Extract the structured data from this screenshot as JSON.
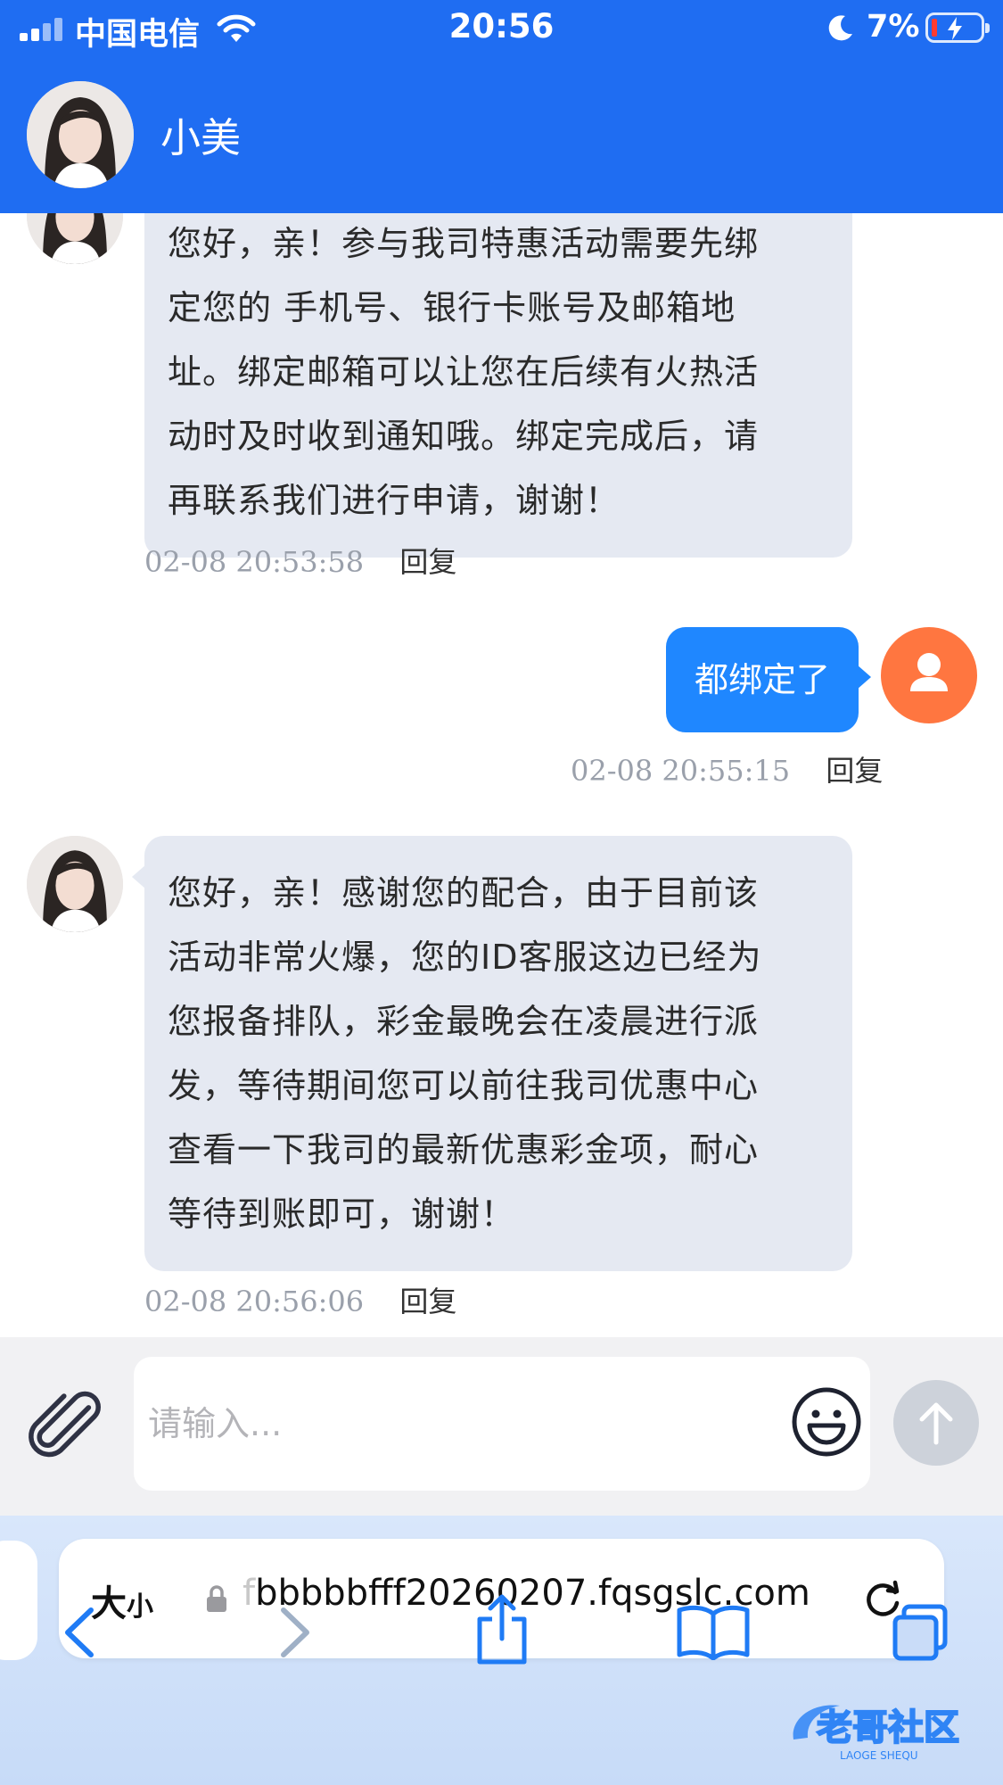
{
  "status_bar": {
    "carrier": "中国电信",
    "time": "20:56",
    "battery": "7%",
    "battery_level": 0.07
  },
  "header": {
    "contact_name": "小美"
  },
  "messages": [
    {
      "side": "left",
      "lines": [
        "您好，亲！参与我司特惠活动需要先绑",
        "定您的 手机号、银行卡账号及邮箱地",
        "址。绑定邮箱可以让您在后续有火热活",
        "动时及时收到通知哦。绑定完成后，请",
        "再联系我们进行申请，谢谢！"
      ],
      "timestamp": "02-08 20:53:58",
      "reply": "回复"
    },
    {
      "side": "right",
      "text": "都绑定了",
      "timestamp": "02-08 20:55:15",
      "reply": "回复"
    },
    {
      "side": "left",
      "lines": [
        "您好，亲！感谢您的配合，由于目前该",
        "活动非常火爆，您的ID客服这边已经为",
        "您报备排队，彩金最晚会在凌晨进行派",
        "发，等待期间您可以前往我司优惠中心",
        "查看一下我司的最新优惠彩金项，耐心",
        "等待到账即可，谢谢！"
      ],
      "timestamp": "02-08 20:56:06",
      "reply": "回复"
    }
  ],
  "input": {
    "placeholder": "请输入..."
  },
  "browser": {
    "text_size": "大",
    "text_size_small": "小",
    "url_faded": "f",
    "url": "bbbbbfff20260207.fqsgslc.com"
  },
  "watermark": {
    "text": "老哥社区",
    "subtext": "LAOGE SHEQU"
  },
  "colors": {
    "header_bg": "#1f6df2",
    "bubble_left": "#e5e9f2",
    "bubble_right": "#1f87ff",
    "user_avatar": "#ff7640"
  }
}
